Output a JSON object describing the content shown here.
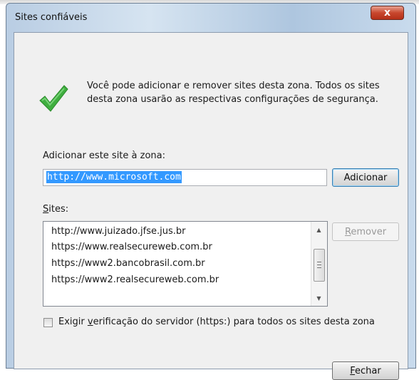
{
  "window": {
    "title": "Sites confiáveis",
    "close_glyph": "x"
  },
  "info": {
    "line1": "Você pode adicionar e remover sites desta zona. Todos os sites",
    "line2": "desta zona usarão as respectivas configurações de segurança.",
    "icon": "green-check-icon"
  },
  "add": {
    "label": "Adicionar este site à zona:",
    "value": "http://www.microsoft.com",
    "button_label": "Adicionar"
  },
  "sites": {
    "label_accel": "S",
    "label_rest": "ites:",
    "items": [
      "http://www.juizado.jfse.jus.br",
      "https://www.realsecureweb.com.br",
      "https://www2.bancobrasil.com.br",
      "https://www2.realsecureweb.com.br"
    ],
    "remove_accel": "R",
    "remove_rest": "emover"
  },
  "https_check": {
    "pre": "Exigir ",
    "accel": "v",
    "post": "erificação do servidor (https:) para todos os sites desta zona",
    "checked": false
  },
  "close_button": {
    "accel": "F",
    "rest": "echar"
  },
  "colors": {
    "selection": "#3399ff",
    "close_red": "#c8472d",
    "check_green": "#3fae3f"
  }
}
